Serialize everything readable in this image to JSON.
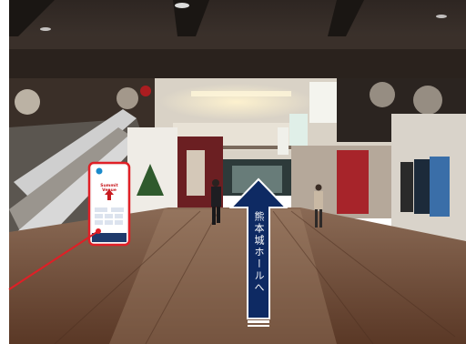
{
  "scene": {
    "description_free": true,
    "direction_sign": {
      "text": "熊本城ホールへ",
      "color_background": "#0e2a63",
      "color_border": "#ffffff"
    },
    "standee": {
      "title": "Summit Venue",
      "highlight_color": "#e01f26"
    },
    "colors": {
      "ceiling": "#2b241f",
      "floor": "#6b4a35",
      "highlight": "#e01f26"
    }
  }
}
